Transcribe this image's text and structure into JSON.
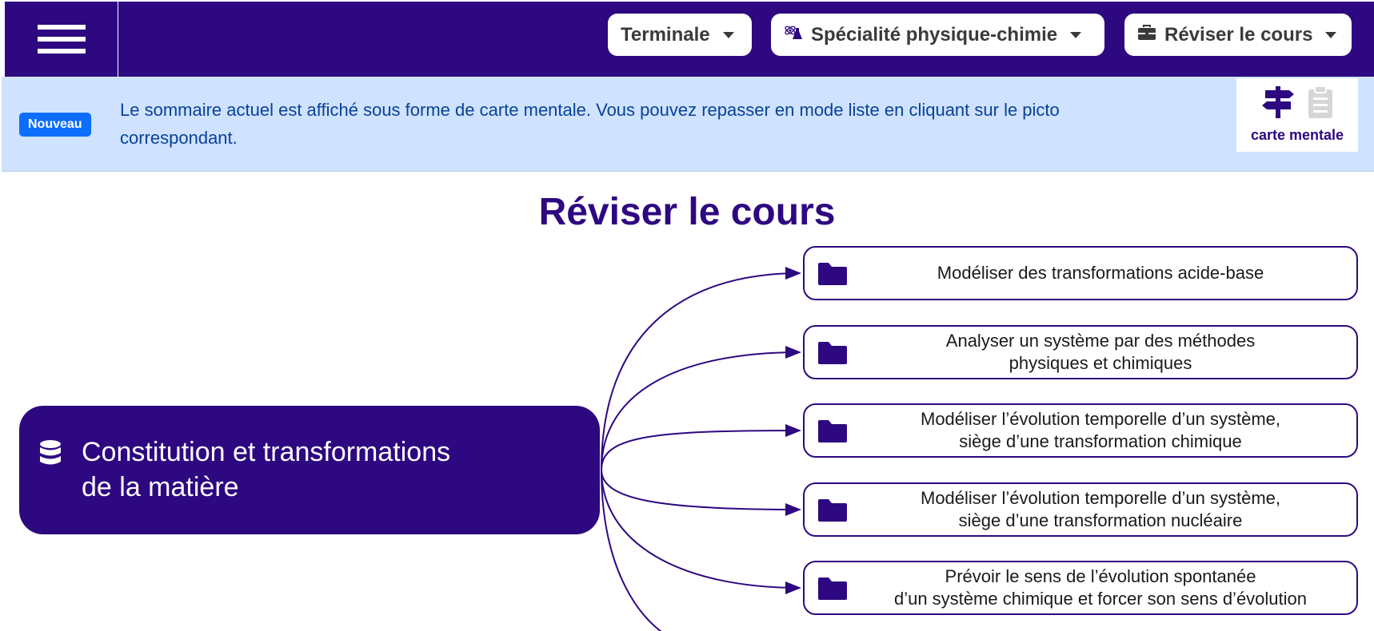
{
  "header": {
    "menu_icon": "hamburger-menu-icon",
    "level": "Terminale",
    "subject": "Spécialité physique-chimie",
    "subject_icon": "flask-atom-icon",
    "section": "Réviser le cours",
    "section_icon": "briefcase-icon"
  },
  "banner": {
    "badge": "Nouveau",
    "message": "Le sommaire actuel est affiché sous forme de carte mentale. Vous pouvez repasser en mode liste en cliquant sur le picto correspondant.",
    "view_label": "carte mentale",
    "mindmap_icon": "signpost-icon",
    "list_icon": "clipboard-list-icon"
  },
  "page_title": "Réviser le cours",
  "mindmap": {
    "root": {
      "label": "Constitution et transformations\nde la matière",
      "icon": "database-icon"
    },
    "children": [
      {
        "label": "Modéliser des transformations acide-base",
        "icon": "folder-icon"
      },
      {
        "label": "Analyser un système par des méthodes\nphysiques et chimiques",
        "icon": "folder-icon"
      },
      {
        "label": "Modéliser l’évolution temporelle d’un système,\nsiège d’une transformation chimique",
        "icon": "folder-icon"
      },
      {
        "label": "Modéliser l’évolution temporelle d’un système,\nsiège d’une transformation nucléaire",
        "icon": "folder-icon"
      },
      {
        "label": "Prévoir le sens de l’évolution spontanée\nd’un système chimique et forcer son sens d’évolution",
        "icon": "folder-icon"
      }
    ]
  },
  "colors": {
    "primary": "#2e0880",
    "banner_bg": "#cfe2ff",
    "banner_text": "#084298",
    "badge": "#0d6efd"
  }
}
